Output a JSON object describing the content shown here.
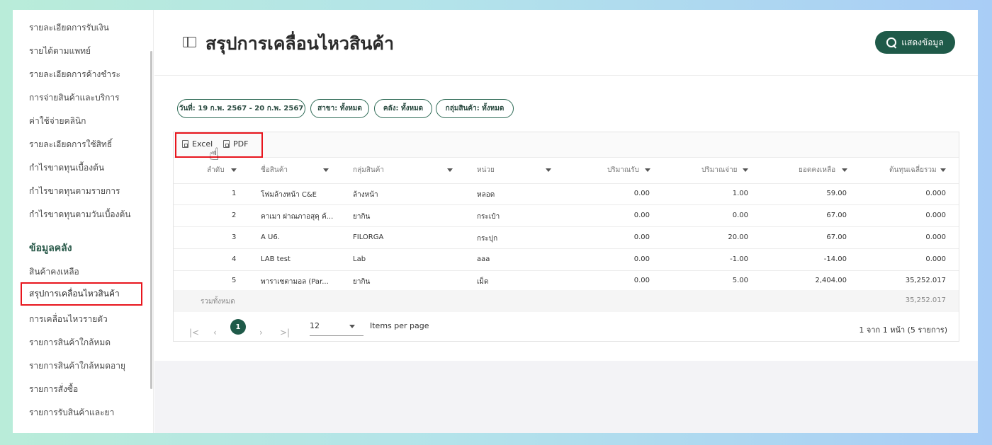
{
  "sidebar": {
    "items_top": [
      "รายละเอียดการรับเงิน",
      "รายได้ตามแพทย์",
      "รายละเอียดการค้างชำระ",
      "การจ่ายสินค้าและบริการ",
      "ค่าใช้จ่ายคลินิก",
      "รายละเอียดการใช้สิทธิ์",
      "กำไรขาดทุนเบื้องต้น",
      "กำไรขาดทุนตามรายการ",
      "กำไรขาดทุนตามวันเบื้องต้น"
    ],
    "section_heading": "ข้อมูลคลัง",
    "items_bottom": [
      "สินค้าคงเหลือ",
      "สรุปการเคลื่อนไหวสินค้า",
      "การเคลื่อนไหวรายตัว",
      "รายการสินค้าใกล้หมด",
      "รายการสินค้าใกล้หมดอายุ",
      "รายการสั่งซื้อ",
      "รายการรับสินค้าและยา"
    ],
    "active_index": 1
  },
  "header": {
    "title": "สรุปการเคลื่อนไหวสินค้า",
    "show_button": "แสดงข้อมูล",
    "icon": "sidebar-panel-icon"
  },
  "filters": [
    "วันที่: 19 ก.พ. 2567 - 20 ก.พ. 2567",
    "สาขา: ทั้งหมด",
    "คลัง: ทั้งหมด",
    "กลุ่มสินค้า: ทั้งหมด"
  ],
  "toolbar": {
    "excel_label": "Excel",
    "pdf_label": "PDF"
  },
  "table": {
    "columns": [
      "ลำดับ",
      "ชื่อสินค้า",
      "กลุ่มสินค้า",
      "หน่วย",
      "ปริมาณรับ",
      "ปริมาณจ่าย",
      "ยอดคงเหลือ",
      "ต้นทุนเฉลี่ยรวม"
    ],
    "rows": [
      [
        "1",
        "โฟมล้างหน้า C&E",
        "ล้างหน้า",
        "หลอด",
        "0.00",
        "1.00",
        "59.00",
        "0.000"
      ],
      [
        "2",
        "คาเมา ฝาณภาอสุคุ ค้...",
        "ยากิน",
        "กระเป๋า",
        "0.00",
        "0.00",
        "67.00",
        "0.000"
      ],
      [
        "3",
        "A U6.",
        "FILORGA",
        "กระปุก",
        "0.00",
        "20.00",
        "67.00",
        "0.000"
      ],
      [
        "4",
        "LAB test",
        "Lab",
        "aaa",
        "0.00",
        "-1.00",
        "-14.00",
        "0.000"
      ],
      [
        "5",
        "พาราเซตามอล (Par...",
        "ยากิน",
        "เม็ด",
        "0.00",
        "5.00",
        "2,404.00",
        "35,252.017"
      ]
    ],
    "total_label": "รวมทั้งหมด",
    "total_value": "35,252.017"
  },
  "pagination": {
    "current_page": "1",
    "per_page": "12",
    "per_page_label": "Items per page",
    "summary": "1 จาก 1 หน้า (5 รายการ)"
  },
  "colors": {
    "accent": "#1f5a49",
    "highlight_box": "#e8151d"
  }
}
